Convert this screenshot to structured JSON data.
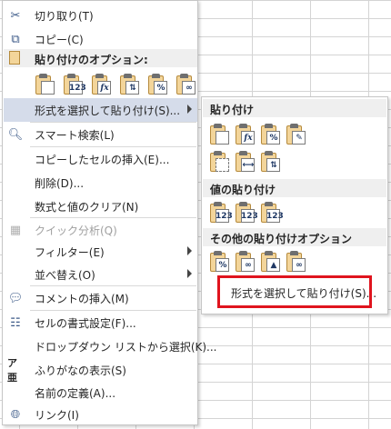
{
  "menu": {
    "cut": "切り取り(T)",
    "copy": "コピー(C)",
    "paste_options_header": "貼り付けのオプション:",
    "paste_special": "形式を選択して貼り付け(S)...",
    "smart_lookup": "スマート検索(L)",
    "insert_copied": "コピーしたセルの挿入(E)...",
    "delete": "削除(D)...",
    "clear_contents": "数式と値のクリア(N)",
    "quick_analysis": "クイック分析(Q)",
    "filter": "フィルター(E)",
    "sort": "並べ替え(O)",
    "insert_comment": "コメントの挿入(M)",
    "format_cells": "セルの書式設定(F)...",
    "pick_from_list": "ドロップダウン リストから選択(K)...",
    "show_furigana": "ふりがなの表示(S)",
    "define_name": "名前の定義(A)...",
    "link": "リンク(I)"
  },
  "paste_icons": {
    "row1": [
      "",
      "123",
      "fx",
      "⇅",
      "%",
      "∞"
    ]
  },
  "submenu": {
    "paste_header": "貼り付け",
    "values_header": "値の貼り付け",
    "other_header": "その他の貼り付けオプション",
    "paste_special": "形式を選択して貼り付け(S)...",
    "paste_row1": [
      "",
      "fx",
      "%",
      "✎"
    ],
    "paste_row2": [
      "",
      "⟷",
      "⇅"
    ],
    "values_row": [
      "123",
      "123",
      "123"
    ],
    "other_row": [
      "%",
      "∞",
      "▲",
      "∞"
    ]
  },
  "colors": {
    "highlight": "#d5dcea",
    "red_outline": "#e0141e",
    "header_bg": "#efefef"
  }
}
